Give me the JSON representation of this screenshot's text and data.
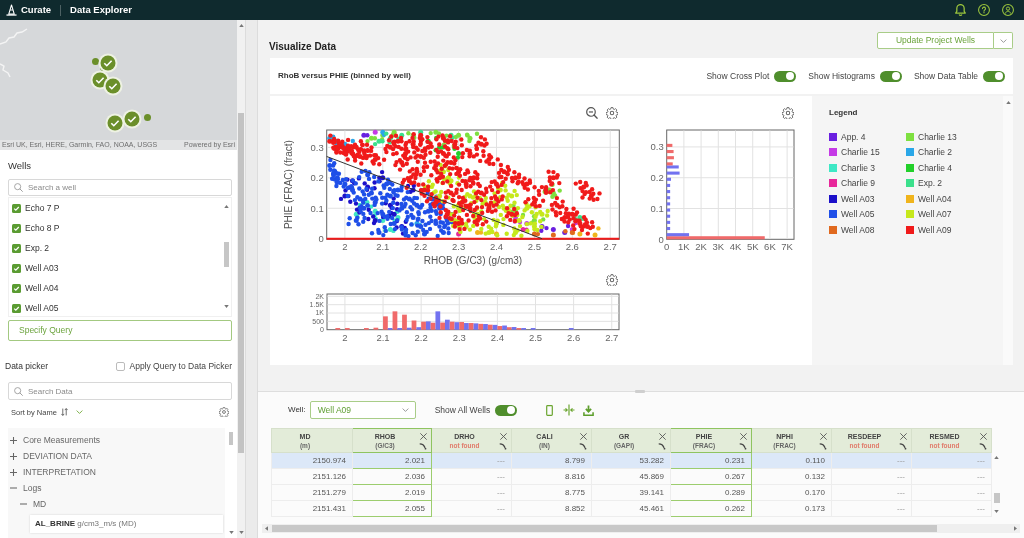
{
  "app_bar": {
    "product": "Curate",
    "section": "Data Explorer"
  },
  "map": {
    "attribution": "Esri UK, Esri, HERE, Garmin, FAO, NOAA, USGS",
    "powered_by": "Powered by Esri"
  },
  "wells": {
    "title": "Wells",
    "search": {
      "placeholder": "Search a well"
    },
    "items": [
      {
        "label": "Echo 7 P",
        "checked": true
      },
      {
        "label": "Echo 8 P",
        "checked": true
      },
      {
        "label": "Exp. 2",
        "checked": true
      },
      {
        "label": "Well A03",
        "checked": true
      },
      {
        "label": "Well A04",
        "checked": true
      },
      {
        "label": "Well A05",
        "checked": true
      }
    ],
    "query_button": "Specify Query"
  },
  "data_picker": {
    "title": "Data picker",
    "apply_query": {
      "label": "Apply Query to Data Picker",
      "checked": false
    },
    "search": {
      "placeholder": "Search Data"
    },
    "sort": {
      "label": "Sort by Name"
    },
    "tree": [
      {
        "label": "Core Measurements",
        "expanded": false
      },
      {
        "label": "DEVIATION DATA",
        "expanded": false
      },
      {
        "label": "INTERPRETATION",
        "expanded": false
      },
      {
        "label": "Logs",
        "expanded": true,
        "children": [
          {
            "label": "MD",
            "expanded": true,
            "children": [
              {
                "label": "**AL_BRINE** g/cm3_m/s (MD)"
              }
            ]
          }
        ]
      }
    ]
  },
  "visualize": {
    "title": "Visualize Data",
    "update_button": "Update Project Wells",
    "plot_title": "RhoB versus PHIE (binned by well)",
    "toggles": [
      {
        "label": "Show Cross Plot",
        "on": true
      },
      {
        "label": "Show Histograms",
        "on": true
      },
      {
        "label": "Show Data Table",
        "on": true
      }
    ]
  },
  "cross_plot": {
    "x_title": "RHOB (G/C3) (g/cm3)",
    "y_title": "PHIE (FRAC) (fract)",
    "x_tick_labels": [
      "2",
      "2.1",
      "2.2",
      "2.3",
      "2.4",
      "2.5",
      "2.6",
      "2.7"
    ],
    "y_tick_labels": [
      "0.3",
      "0.2",
      "0.1",
      "0"
    ]
  },
  "phie_histogram": {
    "chart_data": {
      "type": "bar",
      "orientation": "horizontal",
      "x": [
        0.01,
        0.03,
        0.05,
        0.07,
        0.09,
        0.11,
        0.13,
        0.15,
        0.17,
        0.19,
        0.21,
        0.23,
        0.25,
        0.27,
        0.29,
        0.31,
        0.33,
        0.35
      ],
      "xlim": [
        0,
        7400
      ],
      "ylim": [
        0,
        0.355
      ],
      "xticks": [
        0,
        {
          "value": 1000,
          "label": "1K"
        },
        {
          "value": 2000,
          "label": "2K"
        },
        {
          "value": 3000,
          "label": "3K"
        },
        {
          "value": 4000,
          "label": "4K"
        },
        {
          "value": 5000,
          "label": "5K"
        },
        {
          "value": 6000,
          "label": "6K"
        },
        {
          "value": 7000,
          "label": "7K"
        }
      ],
      "yticks": [
        0,
        0.1,
        0.2,
        0.3
      ],
      "grid": true,
      "series": [
        {
          "color": "#f06a6a",
          "values": [
            5700,
            0,
            0,
            0,
            0,
            0,
            0,
            0,
            0,
            0,
            0,
            0,
            350,
            420,
            400,
            330,
            0,
            0
          ]
        },
        {
          "color": "#7272f0",
          "values": [
            1300,
            200,
            200,
            200,
            200,
            200,
            200,
            200,
            200,
            250,
            750,
            700,
            0,
            0,
            0,
            0,
            0,
            0
          ]
        }
      ]
    }
  },
  "rhob_histogram": {
    "chart_data": {
      "type": "bar",
      "x": [
        1.9875,
        2.0125,
        2.0375,
        2.0625,
        2.0875,
        2.1125,
        2.1375,
        2.1625,
        2.1875,
        2.2125,
        2.2375,
        2.2625,
        2.2875,
        2.3125,
        2.3375,
        2.3625,
        2.3875,
        2.4125,
        2.4375,
        2.4625,
        2.4875,
        2.5125,
        2.5375,
        2.5625,
        2.5875,
        2.6125,
        2.6375,
        2.6625
      ],
      "xlim": [
        1.953,
        2.719
      ],
      "ylim": [
        0,
        2140
      ],
      "xticks": [
        2,
        2.1,
        2.2,
        2.3,
        2.4,
        2.5,
        2.6,
        2.7
      ],
      "yticks": [
        0,
        500,
        {
          "value": 1000,
          "label": "1K"
        },
        {
          "value": 1500,
          "label": "1.5K"
        },
        {
          "value": 2000,
          "label": "2K"
        }
      ],
      "grid": true,
      "series": [
        {
          "color": "#f06a6a",
          "values": [
            100,
            100,
            0,
            100,
            120,
            800,
            1100,
            900,
            550,
            480,
            420,
            430,
            480,
            460,
            400,
            350,
            300,
            220,
            150,
            100,
            0,
            0,
            0,
            0,
            0,
            0,
            0,
            0
          ]
        },
        {
          "color": "#7272f0",
          "values": [
            0,
            0,
            0,
            0,
            0,
            100,
            100,
            120,
            150,
            500,
            1100,
            600,
            450,
            400,
            380,
            340,
            290,
            250,
            160,
            100,
            100,
            0,
            0,
            0,
            100,
            0,
            0,
            0
          ]
        }
      ]
    }
  },
  "legend": {
    "title": "Legend",
    "items": [
      {
        "label": "App. 4",
        "color": "#6a1fe0"
      },
      {
        "label": "Charlie 13",
        "color": "#7ee040"
      },
      {
        "label": "Charlie 15",
        "color": "#c53ae6"
      },
      {
        "label": "Charlie 2",
        "color": "#2aa7e8"
      },
      {
        "label": "Charlie 3",
        "color": "#3ee8c5"
      },
      {
        "label": "Charlie 4",
        "color": "#22d02a"
      },
      {
        "label": "Charlie 9",
        "color": "#e8279a"
      },
      {
        "label": "Exp. 2",
        "color": "#3be08c"
      },
      {
        "label": "Well A03",
        "color": "#1c10c9"
      },
      {
        "label": "Well A04",
        "color": "#f0b41c"
      },
      {
        "label": "Well A05",
        "color": "#1f4fe8"
      },
      {
        "label": "Well A07",
        "color": "#c6e81c"
      },
      {
        "label": "Well A08",
        "color": "#e0691f"
      },
      {
        "label": "Well A09",
        "color": "#f01a1a"
      }
    ]
  },
  "data_table": {
    "well_label": "Well:",
    "well": "Well A09",
    "show_all_wells": {
      "label": "Show All Wells",
      "on": true
    },
    "columns": [
      {
        "name": "MD",
        "unit": "(m)",
        "removable": false,
        "selected": false
      },
      {
        "name": "RHOB",
        "unit": "(G/C3)",
        "removable": true,
        "selected": true
      },
      {
        "name": "DRHO",
        "status": "not found",
        "removable": true,
        "selected": false
      },
      {
        "name": "CALI",
        "unit": "(IN)",
        "removable": true,
        "selected": false
      },
      {
        "name": "GR",
        "unit": "(GAPI)",
        "removable": true,
        "selected": false
      },
      {
        "name": "PHIE",
        "unit": "(FRAC)",
        "removable": true,
        "selected": true
      },
      {
        "name": "NPHI",
        "unit": "(FRAC)",
        "removable": true,
        "selected": false
      },
      {
        "name": "RESDEEP",
        "status": "not found",
        "removable": true,
        "selected": false
      },
      {
        "name": "RESMED",
        "status": "not found",
        "removable": true,
        "selected": false
      }
    ],
    "rows": [
      {
        "selected": true,
        "cells": [
          "2150.974",
          "2.021",
          "---",
          "8.799",
          "53.282",
          "0.231",
          "0.110",
          "---",
          "---"
        ]
      },
      {
        "selected": false,
        "cells": [
          "2151.126",
          "2.036",
          "---",
          "8.816",
          "45.869",
          "0.267",
          "0.132",
          "---",
          "---"
        ]
      },
      {
        "selected": false,
        "cells": [
          "2151.279",
          "2.019",
          "---",
          "8.775",
          "39.141",
          "0.289",
          "0.170",
          "---",
          "---"
        ]
      },
      {
        "selected": false,
        "cells": [
          "2151.431",
          "2.055",
          "---",
          "8.852",
          "45.461",
          "0.262",
          "0.173",
          "---",
          "---"
        ]
      }
    ]
  }
}
